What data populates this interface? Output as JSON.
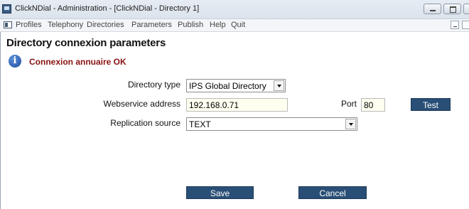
{
  "window": {
    "title": "ClickNDial - Administration - [ClickNDial - Directory 1]"
  },
  "menu": {
    "items": [
      "Profiles",
      "Telephony",
      "Directories",
      "Parameters",
      "Publish",
      "Help",
      "Quit"
    ]
  },
  "page": {
    "title": "Directory connexion parameters",
    "status_message": "Connexion annuaire OK",
    "status_color": "#8a1212"
  },
  "form": {
    "directory_type": {
      "label": "Directory type",
      "value": "IPS Global Directory"
    },
    "webservice_address": {
      "label": "Webservice address",
      "value": "192.168.0.71"
    },
    "port": {
      "label": "Port",
      "value": "80"
    },
    "replication_source": {
      "label": "Replication source",
      "value": "TEXT"
    }
  },
  "buttons": {
    "test": "Test",
    "save": "Save",
    "cancel": "Cancel",
    "color": "#2a4f76"
  },
  "icons": {
    "app": "app-icon",
    "info": "info-icon",
    "info_glyph": "i"
  }
}
